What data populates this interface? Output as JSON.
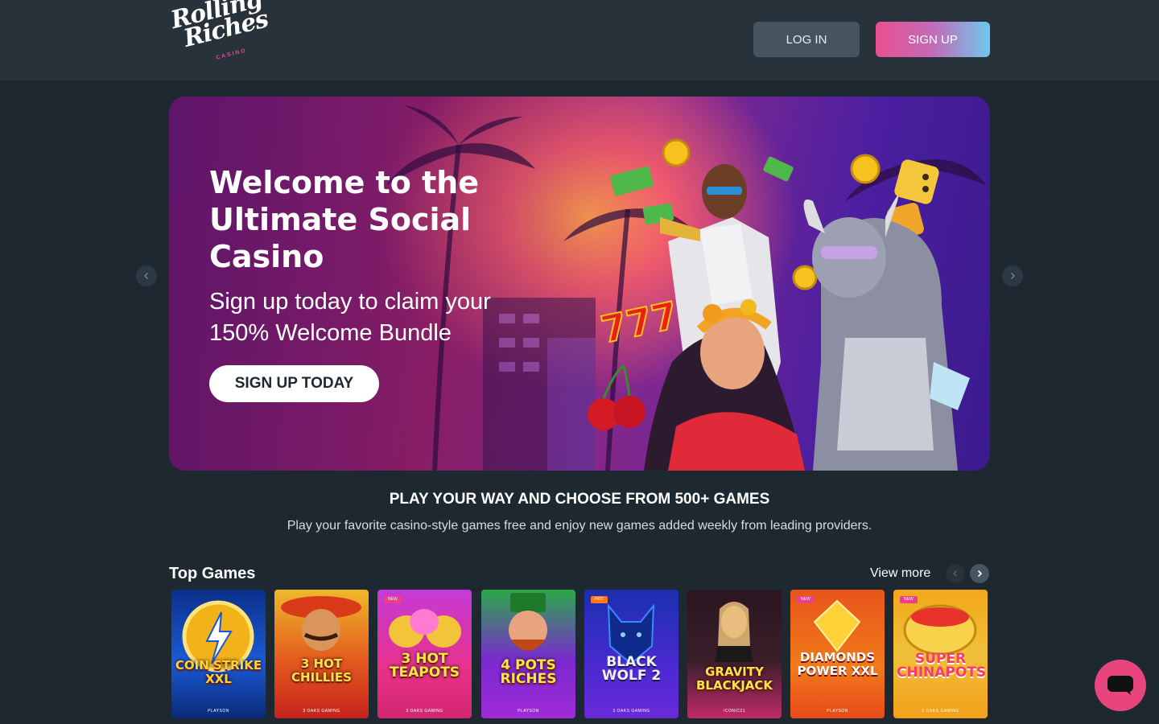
{
  "header": {
    "logo_line1": "Rolling",
    "logo_line2": "Riches",
    "logo_sub": "CASINO",
    "login_label": "LOG IN",
    "signup_label": "SIGN UP"
  },
  "hero": {
    "title": "Welcome to the Ultimate Social Casino",
    "subtitle": "Sign up today to claim your 150% Welcome Bundle",
    "cta_label": "SIGN UP TODAY",
    "prev_icon": "chevron-left-icon",
    "next_icon": "chevron-right-icon"
  },
  "games_section": {
    "title": "PLAY YOUR WAY AND CHOOSE FROM 500+ GAMES",
    "subtitle": "Play your favorite casino-style games free and enjoy new games added weekly from leading providers."
  },
  "top_games": {
    "title": "Top Games",
    "view_more": "View more",
    "items": [
      {
        "name": "COIN STRIKE XXL",
        "provider": "PLAYSON",
        "badge": ""
      },
      {
        "name": "3 HOT CHILLIES",
        "provider": "3 OAKS GAMING",
        "badge": ""
      },
      {
        "name": "3 HOT TEAPOTS",
        "provider": "3 OAKS GAMING",
        "badge": "NEW"
      },
      {
        "name": "4 POTS RICHES",
        "provider": "PLAYSON",
        "badge": ""
      },
      {
        "name": "BLACK WOLF 2",
        "provider": "3 OAKS GAMING",
        "badge": "HOT"
      },
      {
        "name": "GRAVITY BLACKJACK",
        "provider": "ICONIC21",
        "badge": ""
      },
      {
        "name": "DIAMONDS POWER XXL",
        "provider": "PLAYSON",
        "badge": "NEW"
      },
      {
        "name": "SUPER CHINAPOTS",
        "provider": "3 OAKS GAMING",
        "badge": "NEW"
      }
    ]
  },
  "colors": {
    "page_bg": "#1d2830",
    "header_bg": "#27323b",
    "accent_pink": "#e8508f",
    "accent_blue": "#6fc7ee",
    "chat_bg": "#e8457f"
  },
  "chat": {
    "icon": "chat-bubble-icon"
  }
}
